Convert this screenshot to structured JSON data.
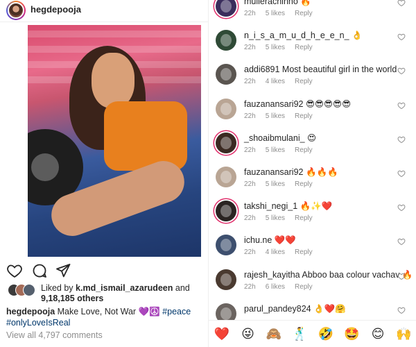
{
  "post": {
    "username": "hegdepooja",
    "likes_prefix": "Liked by ",
    "liked_by_user": "k.md_ismail_azarudeen",
    "likes_and": " and",
    "likes_others": "9,18,185 others",
    "caption_user": "hegdepooja",
    "caption_text": " Make Love, Not War 💜☮️ ",
    "caption_tag1": "#peace",
    "caption_tag2": "#onlyLoveIsReal",
    "view_all": "View all 4,797 comments"
  },
  "icons": {
    "like": "heart-outline-icon",
    "comment": "comment-bubble-icon",
    "share": "paper-plane-icon"
  },
  "comments": [
    {
      "user": "mullerachinho",
      "text": " 🔥",
      "time": "22h",
      "likes": "5 likes",
      "reply": "Reply",
      "avatar_color": "#3a2d5c"
    },
    {
      "user": "n_i_s_a_m_u_d_h_e_e_n_",
      "text": " 👌",
      "time": "22h",
      "likes": "5 likes",
      "reply": "Reply",
      "avatar_color": "#2f4a36"
    },
    {
      "user": "addi6891",
      "text": " Most beautiful girl in the world",
      "time": "22h",
      "likes": "4 likes",
      "reply": "Reply",
      "avatar_color": "#5a5550"
    },
    {
      "user": "fauzanansari92",
      "text": " 😎😎😎😎😎",
      "time": "22h",
      "likes": "5 likes",
      "reply": "Reply",
      "avatar_color": "#b9a594"
    },
    {
      "user": "_shoaibmulani_",
      "text": " 😍",
      "time": "22h",
      "likes": "5 likes",
      "reply": "Reply",
      "avatar_color": "#3b2a22"
    },
    {
      "user": "fauzanansari92",
      "text": " 🔥🔥🔥",
      "time": "22h",
      "likes": "5 likes",
      "reply": "Reply",
      "avatar_color": "#b9a594"
    },
    {
      "user": "takshi_negi_1",
      "text": " 🔥✨❤️",
      "time": "22h",
      "likes": "5 likes",
      "reply": "Reply",
      "avatar_color": "#2a2422"
    },
    {
      "user": "ichu.ne",
      "text": " ❤️❤️",
      "time": "22h",
      "likes": "4 likes",
      "reply": "Reply",
      "avatar_color": "#3d4f6e"
    },
    {
      "user": "rajesh_kayitha",
      "text": " Abboo baa colour vachav 🔥",
      "time": "22h",
      "likes": "6 likes",
      "reply": "Reply",
      "avatar_color": "#4a3a30"
    },
    {
      "user": "parul_pandey824",
      "text": " 👌❤️🤗",
      "time": "",
      "likes": "",
      "reply": "",
      "avatar_color": "#6b6460"
    }
  ],
  "emoji_bar": [
    "❤️",
    "😜",
    "🙈",
    "🕺",
    "🤣",
    "🤩",
    "😊",
    "🙌"
  ],
  "colors": {
    "link": "#00376b",
    "muted": "#8e8e8e",
    "text": "#262626",
    "heart": "#ed4956"
  }
}
